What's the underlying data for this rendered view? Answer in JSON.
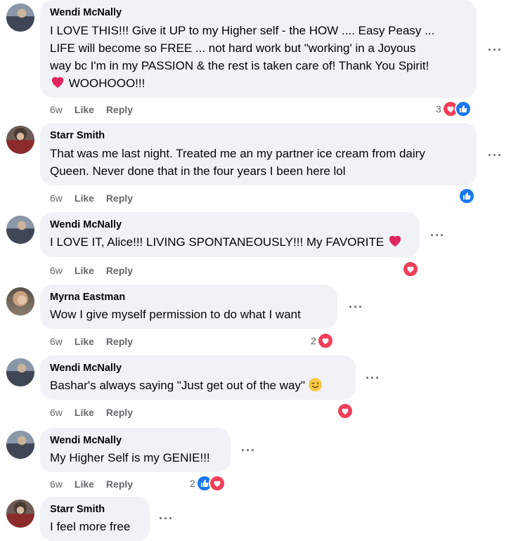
{
  "comments": [
    {
      "author": "Wendi McNally",
      "lines": [
        "I LOVE THIS!!! Give it UP to my Higher self - the HOW .... Easy Peasy ...",
        "LIFE will become so FREE ... not hard work but \"working' in a Joyous",
        "way bc I'm in my PASSION & the rest is taken care of! Thank You Spirit!",
        "WOOHOOO!!!"
      ],
      "time": "6w",
      "like": "Like",
      "reply": "Reply",
      "reaction_count": "3",
      "reactions": [
        "love",
        "like"
      ]
    },
    {
      "author": "Starr Smith",
      "lines": [
        "That was me last night. Treated me an my partner ice cream from dairy",
        "Queen. Never done that in the four years I been here lol"
      ],
      "time": "6w",
      "like": "Like",
      "reply": "Reply",
      "reaction_count": "",
      "reactions": [
        "like"
      ]
    },
    {
      "author": "Wendi McNally",
      "lines": [
        "I LOVE IT, Alice!!! LIVING SPONTANEOUSLY!!! My FAVORITE"
      ],
      "time": "6w",
      "like": "Like",
      "reply": "Reply",
      "reaction_count": "",
      "reactions": [
        "love"
      ]
    },
    {
      "author": "Myrna Eastman",
      "lines": [
        "Wow I give myself permission to do what I want"
      ],
      "time": "6w",
      "like": "Like",
      "reply": "Reply",
      "reaction_count": "2",
      "reactions": [
        "love"
      ]
    },
    {
      "author": "Wendi McNally",
      "lines": [
        "Bashar's always saying \"Just get out of the way\""
      ],
      "time": "6w",
      "like": "Like",
      "reply": "Reply",
      "reaction_count": "",
      "reactions": [
        "love"
      ]
    },
    {
      "author": "Wendi McNally",
      "lines": [
        "My Higher Self is my GENIE!!!"
      ],
      "time": "6w",
      "like": "Like",
      "reply": "Reply",
      "reaction_count": "2",
      "reactions": [
        "like",
        "love"
      ]
    },
    {
      "author": "Starr Smith",
      "lines": [
        "I feel more free"
      ],
      "time": "",
      "like": "",
      "reply": "",
      "reaction_count": "",
      "reactions": []
    }
  ],
  "more_glyph": "···",
  "colors": {
    "love": "#f33e58",
    "like": "#1877f2",
    "bubble": "#f0f2f5",
    "meta": "#65676b"
  }
}
